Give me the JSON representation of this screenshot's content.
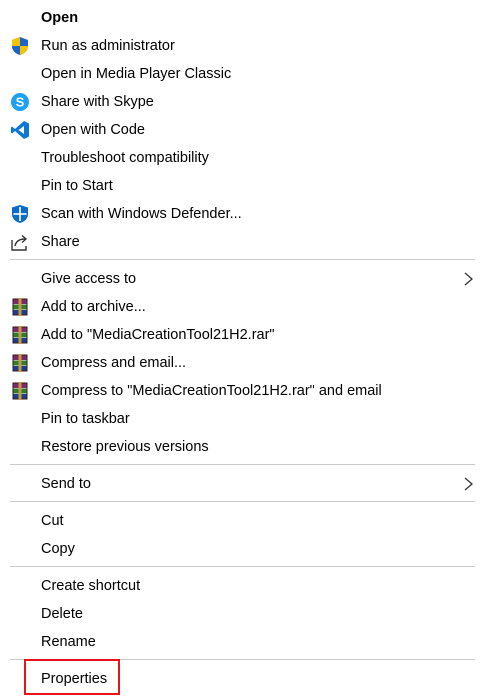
{
  "context_menu": {
    "items": [
      {
        "label": "Open",
        "icon": "none"
      },
      {
        "label": "Run as administrator",
        "icon": "uac-shield-icon"
      },
      {
        "label": "Open in Media Player Classic",
        "icon": "none"
      },
      {
        "label": "Share with Skype",
        "icon": "skype-icon"
      },
      {
        "label": "Open with Code",
        "icon": "vscode-icon"
      },
      {
        "label": "Troubleshoot compatibility",
        "icon": "none"
      },
      {
        "label": "Pin to Start",
        "icon": "none"
      },
      {
        "label": "Scan with Windows Defender...",
        "icon": "windows-defender-icon"
      },
      {
        "label": "Share",
        "icon": "share-icon"
      },
      {
        "label": "Give access to",
        "icon": "none",
        "submenu": true
      },
      {
        "label": "Add to archive...",
        "icon": "winrar-icon"
      },
      {
        "label": "Add to \"MediaCreationTool21H2.rar\"",
        "icon": "winrar-icon"
      },
      {
        "label": "Compress and email...",
        "icon": "winrar-icon"
      },
      {
        "label": "Compress to \"MediaCreationTool21H2.rar\" and email",
        "icon": "winrar-icon"
      },
      {
        "label": "Pin to taskbar",
        "icon": "none"
      },
      {
        "label": "Restore previous versions",
        "icon": "none"
      },
      {
        "label": "Send to",
        "icon": "none",
        "submenu": true
      },
      {
        "label": "Cut",
        "icon": "none"
      },
      {
        "label": "Copy",
        "icon": "none"
      },
      {
        "label": "Create shortcut",
        "icon": "none"
      },
      {
        "label": "Delete",
        "icon": "none"
      },
      {
        "label": "Rename",
        "icon": "none"
      },
      {
        "label": "Properties",
        "icon": "none",
        "highlighted": true
      }
    ]
  },
  "colors": {
    "highlight_border": "#e8141c",
    "separator": "#c9c9c9",
    "uac_blue": "#1e64c8",
    "uac_yellow": "#f5c400",
    "skype_blue": "#1da1f2",
    "vscode_blue": "#0a78d4",
    "defender_blue": "#0b6cc8"
  }
}
